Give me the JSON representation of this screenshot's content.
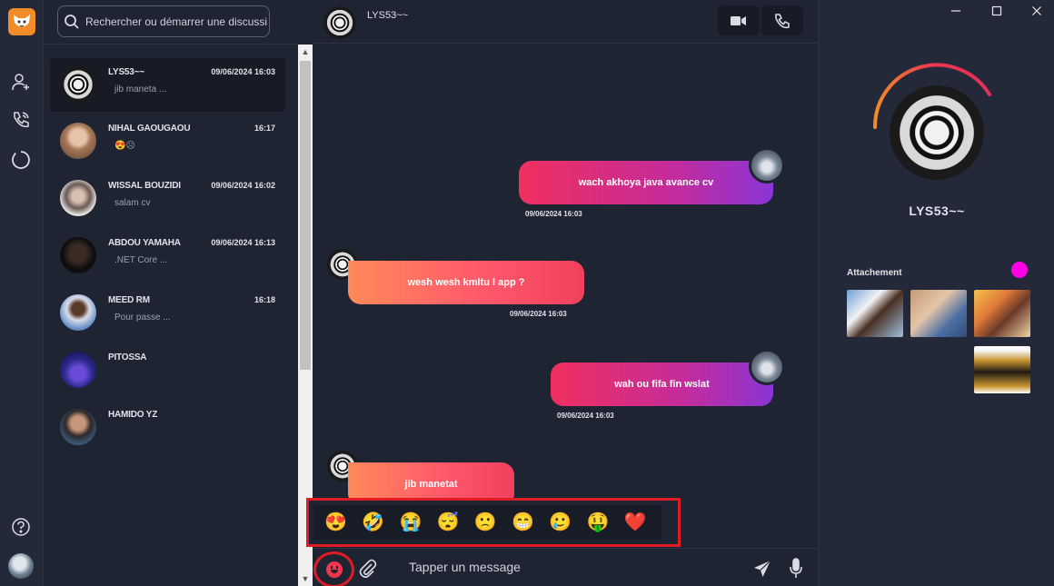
{
  "search": {
    "placeholder": "Rechercher ou démarrer une discussion"
  },
  "conversations": [
    {
      "name": "LYS53~~",
      "time": "09/06/2024 16:03",
      "preview": "jib maneta ..."
    },
    {
      "name": "NIHAL GAOUGAOU",
      "time": "16:17",
      "preview": "😍☹"
    },
    {
      "name": "WISSAL BOUZIDI",
      "time": "09/06/2024 16:02",
      "preview": "salam cv"
    },
    {
      "name": "ABDOU YAMAHA",
      "time": "09/06/2024 16:13",
      "preview": ".NET Core  ..."
    },
    {
      "name": "MEED RM",
      "time": "16:18",
      "preview": "Pour passe ..."
    },
    {
      "name": "PITOSSA",
      "time": "",
      "preview": ""
    },
    {
      "name": "HAMIDO YZ",
      "time": "",
      "preview": ""
    }
  ],
  "chat": {
    "title": "LYS53~~",
    "messages": [
      {
        "direction": "out",
        "text": "wach akhoya java avance cv",
        "time": "09/06/2024 16:03"
      },
      {
        "direction": "in",
        "text": "wesh wesh kmltu l app ?",
        "time": "09/06/2024 16:03"
      },
      {
        "direction": "out",
        "text": "wah ou fifa fin wslat",
        "time": "09/06/2024 16:03"
      },
      {
        "direction": "in",
        "text": "jib manetat",
        "time": ""
      }
    ]
  },
  "emoji_picker": [
    "😍",
    "🤣",
    "😭",
    "😴",
    "🙁",
    "😁",
    "🥲",
    "🤑",
    "❤️"
  ],
  "composer": {
    "placeholder": "Tapper un message"
  },
  "profile": {
    "name": "LYS53~~",
    "attachments_title": "Attachement"
  },
  "icons": {
    "logo": "fox-logo-icon",
    "add_contact": "add-user-icon",
    "calls": "phone-call-icon",
    "status": "status-ring-icon",
    "help": "help-icon",
    "video": "video-icon",
    "phone": "phone-icon",
    "emoji": "smiley-icon",
    "attach": "paperclip-icon",
    "send": "send-icon",
    "mic": "microphone-icon"
  },
  "colors": {
    "accent": "#e01b24",
    "outgoing_start": "#f02f5e",
    "outgoing_end": "#8a35d6",
    "incoming_start": "#ff8a5a",
    "incoming_end": "#f1405e",
    "attachment_dot": "#ff00e6"
  }
}
